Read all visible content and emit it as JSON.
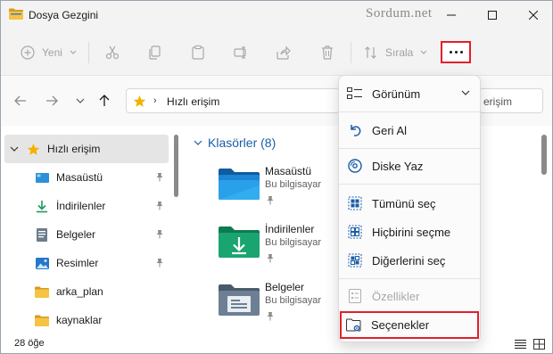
{
  "window": {
    "title": "Dosya Gezgini",
    "watermark": "Sordum.net",
    "controls": [
      "minimize-icon",
      "maximize-icon",
      "close-icon"
    ]
  },
  "toolbar": {
    "new_label": "Yeni",
    "sort_label": "Sırala",
    "more_label": "..."
  },
  "address": {
    "path_label": "Hızlı erişim",
    "search_partial": "erişim"
  },
  "sidebar": {
    "items": [
      {
        "label": "Hızlı erişim",
        "icon": "star-icon",
        "selected": true
      },
      {
        "label": "Masaüstü",
        "icon": "desktop-icon",
        "pinned": true
      },
      {
        "label": "İndirilenler",
        "icon": "download-icon",
        "pinned": true
      },
      {
        "label": "Belgeler",
        "icon": "document-icon",
        "pinned": true
      },
      {
        "label": "Resimler",
        "icon": "picture-icon",
        "pinned": true
      },
      {
        "label": "arka_plan",
        "icon": "folder-icon",
        "pinned": false
      },
      {
        "label": "kaynaklar",
        "icon": "folder-icon",
        "pinned": false
      }
    ]
  },
  "main": {
    "group_title": "Klasörler (8)",
    "folders": [
      {
        "name": "Masaüstü",
        "sub": "Bu bilgisayar",
        "icon": "desktop-folder-icon"
      },
      {
        "name": "İndirilenler",
        "sub": "Bu bilgisayar",
        "icon": "downloads-folder-icon"
      },
      {
        "name": "Belgeler",
        "sub": "Bu bilgisayar",
        "icon": "documents-folder-icon"
      }
    ]
  },
  "menu": {
    "items": [
      {
        "label": "Görünüm",
        "icon": "view-icon",
        "has_submenu": true
      },
      {
        "label": "Geri Al",
        "icon": "undo-icon"
      },
      {
        "label": "Diske Yaz",
        "icon": "burn-disc-icon"
      },
      {
        "label": "Tümünü seç",
        "icon": "select-all-icon"
      },
      {
        "label": "Hiçbirini seçme",
        "icon": "select-none-icon"
      },
      {
        "label": "Diğerlerini seç",
        "icon": "invert-selection-icon"
      },
      {
        "label": "Özellikler",
        "icon": "properties-icon",
        "disabled": true
      },
      {
        "label": "Seçenekler",
        "icon": "options-icon",
        "highlighted": true
      }
    ]
  },
  "status": {
    "item_count": "28 öğe"
  },
  "colors": {
    "accent": "#1a5da8",
    "highlight_border": "#e0202a",
    "star": "#f2b200"
  }
}
